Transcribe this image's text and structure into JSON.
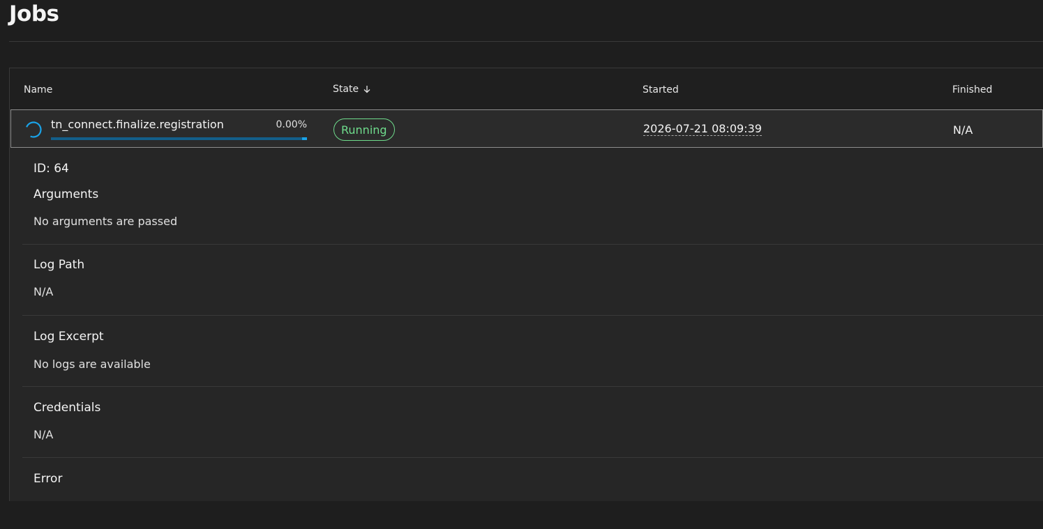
{
  "page": {
    "title": "Jobs"
  },
  "table": {
    "headers": {
      "name": "Name",
      "state": "State",
      "started": "Started",
      "finished": "Finished"
    },
    "sort_icon": "arrow-down-icon",
    "rows": [
      {
        "name": "tn_connect.finalize.registration",
        "progress_text": "0.00%",
        "progress_fraction": 0.0,
        "state": "Running",
        "state_color": "#6fdc8c",
        "started": "2026-07-21 08:09:39",
        "finished": "N/A"
      }
    ]
  },
  "details": {
    "id_label": "ID: 64",
    "sections": [
      {
        "title": "Arguments",
        "value": "No arguments are passed"
      },
      {
        "title": "Log Path",
        "value": "N/A"
      },
      {
        "title": "Log Excerpt",
        "value": "No logs are available"
      },
      {
        "title": "Credentials",
        "value": "N/A"
      },
      {
        "title": "Error",
        "value": ""
      }
    ]
  },
  "colors": {
    "background": "#1e1e1e",
    "table_background": "#262626",
    "accent": "#0f62fe",
    "spinner": "#1aa3e8",
    "success": "#6fdc8c"
  }
}
